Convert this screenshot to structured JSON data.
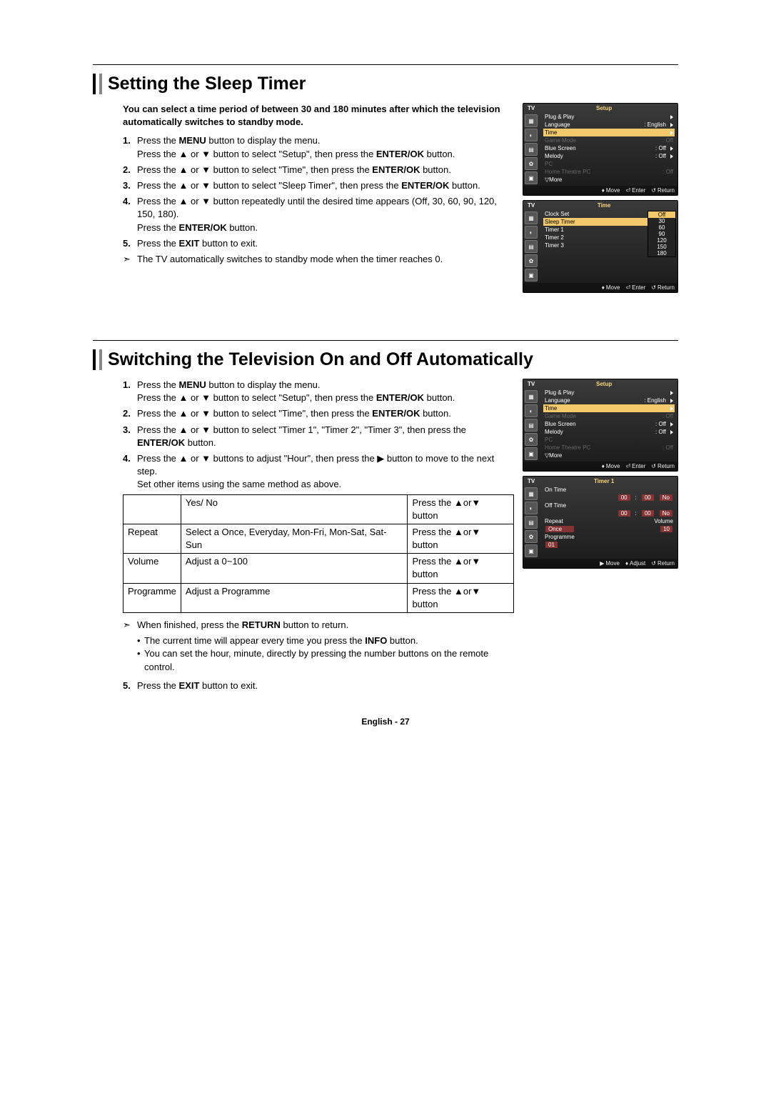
{
  "section1": {
    "heading": "Setting the Sleep Timer",
    "intro": "You can select a time period of between 30 and 180 minutes after which the television automatically switches to standby mode.",
    "steps": [
      "Press the <b>MENU</b> button to display the menu.<br>Press the ▲ or ▼ button to select \"Setup\", then press the <b>ENTER/OK</b> button.",
      "Press the ▲ or ▼ button to select \"Time\", then press the <b>ENTER/OK</b> button.",
      "Press the ▲ or ▼ button to select \"Sleep Timer\", then press the <b>ENTER/OK</b> button.",
      "Press the ▲ or ▼ button repeatedly until the desired time appears (Off, 30, 60, 90, 120, 150, 180).<br>Press the <b>ENTER/OK</b> button.",
      "Press the <b>EXIT</b> button to exit."
    ],
    "note": "The TV automatically switches to standby mode when the timer reaches 0."
  },
  "osdSetup": {
    "tv": "TV",
    "title": "Setup",
    "rows": [
      {
        "k": "Plug & Play",
        "v": "",
        "arrow": true
      },
      {
        "k": "Language",
        "v": ": English",
        "arrow": true
      },
      {
        "k": "Time",
        "hl": true,
        "arrow": true
      },
      {
        "k": "Game Mode",
        "v": ": Off",
        "dim": true
      },
      {
        "k": "Blue Screen",
        "v": ": Off",
        "arrow": true
      },
      {
        "k": "Melody",
        "v": ": Off",
        "arrow": true
      },
      {
        "k": "PC",
        "dim": true
      },
      {
        "k": "Home Theatre PC",
        "v": ": Off",
        "dim": true
      },
      {
        "k": "▽More"
      }
    ],
    "footer": [
      [
        "♦",
        "Move"
      ],
      [
        "⏎",
        "Enter"
      ],
      [
        "↺",
        "Return"
      ]
    ]
  },
  "osdTime": {
    "tv": "TV",
    "title": "Time",
    "rows": [
      {
        "k": "Clock Set",
        "v": ":"
      },
      {
        "k": "Sleep Timer",
        "v": ":",
        "hl": true
      },
      {
        "k": "Timer 1",
        "v": ":"
      },
      {
        "k": "Timer 2",
        "v": ":"
      },
      {
        "k": "Timer 3",
        "v": ":"
      }
    ],
    "popup": [
      "Off",
      "30",
      "60",
      "90",
      "120",
      "150",
      "180"
    ],
    "footer": [
      [
        "♦",
        "Move"
      ],
      [
        "⏎",
        "Enter"
      ],
      [
        "↺",
        "Return"
      ]
    ]
  },
  "section2": {
    "heading": "Switching the Television On and Off Automatically",
    "steps": [
      "Press the <b>MENU</b> button to display the menu.<br>Press the ▲ or ▼ button to select \"Setup\", then press the <b>ENTER/OK</b> button.",
      "Press the ▲ or ▼ button to select \"Time\", then press the <b>ENTER/OK</b> button.",
      "Press the ▲ or ▼ button to select \"Timer 1\", \"Timer 2\", \"Timer 3\", then press the <b>ENTER/OK</b> button.",
      "Press the ▲ or ▼ buttons to adjust \"Hour\", then press the ▶ button to move to the next step.<br>Set other items using the same method as above."
    ],
    "table": [
      [
        "",
        "Yes/ No",
        "Press the ▲or▼ button"
      ],
      [
        "Repeat",
        "Select a Once, Everyday, Mon-Fri, Mon-Sat, Sat-Sun",
        "Press the ▲or▼ button"
      ],
      [
        "Volume",
        "Adjust a 0~100",
        "Press the ▲or▼ button"
      ],
      [
        "Programme",
        "Adjust a Programme",
        "Press the ▲or▼ button"
      ]
    ],
    "note": "When finished, press the <b>RETURN</b> button to return.",
    "bullets": [
      "The current time will appear every time you press the <b>INFO</b> button.",
      "You can set the hour, minute, directly by pressing the number buttons on the remote control."
    ],
    "step5": "Press the <b>EXIT</b> button to exit."
  },
  "osdTimer1": {
    "tv": "TV",
    "title": "Timer 1",
    "onTime": "On Time",
    "offTime": "Off Time",
    "h": "00",
    "m": "00",
    "no": "No",
    "repeat": "Repeat",
    "repeatVal": "Once",
    "volume": "Volume",
    "volumeVal": "10",
    "programme": "Programme",
    "programmeVal": "01",
    "footer": [
      [
        "▶",
        "Move"
      ],
      [
        "♦",
        "Adjust"
      ],
      [
        "↺",
        "Return"
      ]
    ]
  },
  "pageNum": "English - 27"
}
